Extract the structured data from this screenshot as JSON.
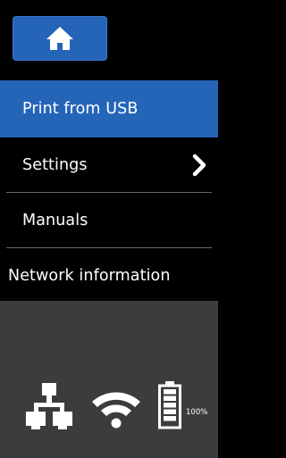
{
  "header": {
    "home_icon": "home-icon",
    "accent_color": "#2565b8"
  },
  "menu": {
    "items": [
      {
        "label": "Print from USB",
        "selected": true,
        "has_submenu": false
      },
      {
        "label": "Settings",
        "selected": false,
        "has_submenu": true,
        "submenu_icon": "chevron-right-icon"
      },
      {
        "label": "Manuals",
        "selected": false,
        "has_submenu": false
      },
      {
        "label": "Network information",
        "selected": false,
        "has_submenu": false
      }
    ]
  },
  "status_bar": {
    "background_color": "#3a3c3d",
    "network_icon": "wired-network-icon",
    "wifi_icon": "wifi-icon",
    "battery_icon": "battery-icon",
    "battery_level": 1.0,
    "battery_percent": "100%"
  }
}
